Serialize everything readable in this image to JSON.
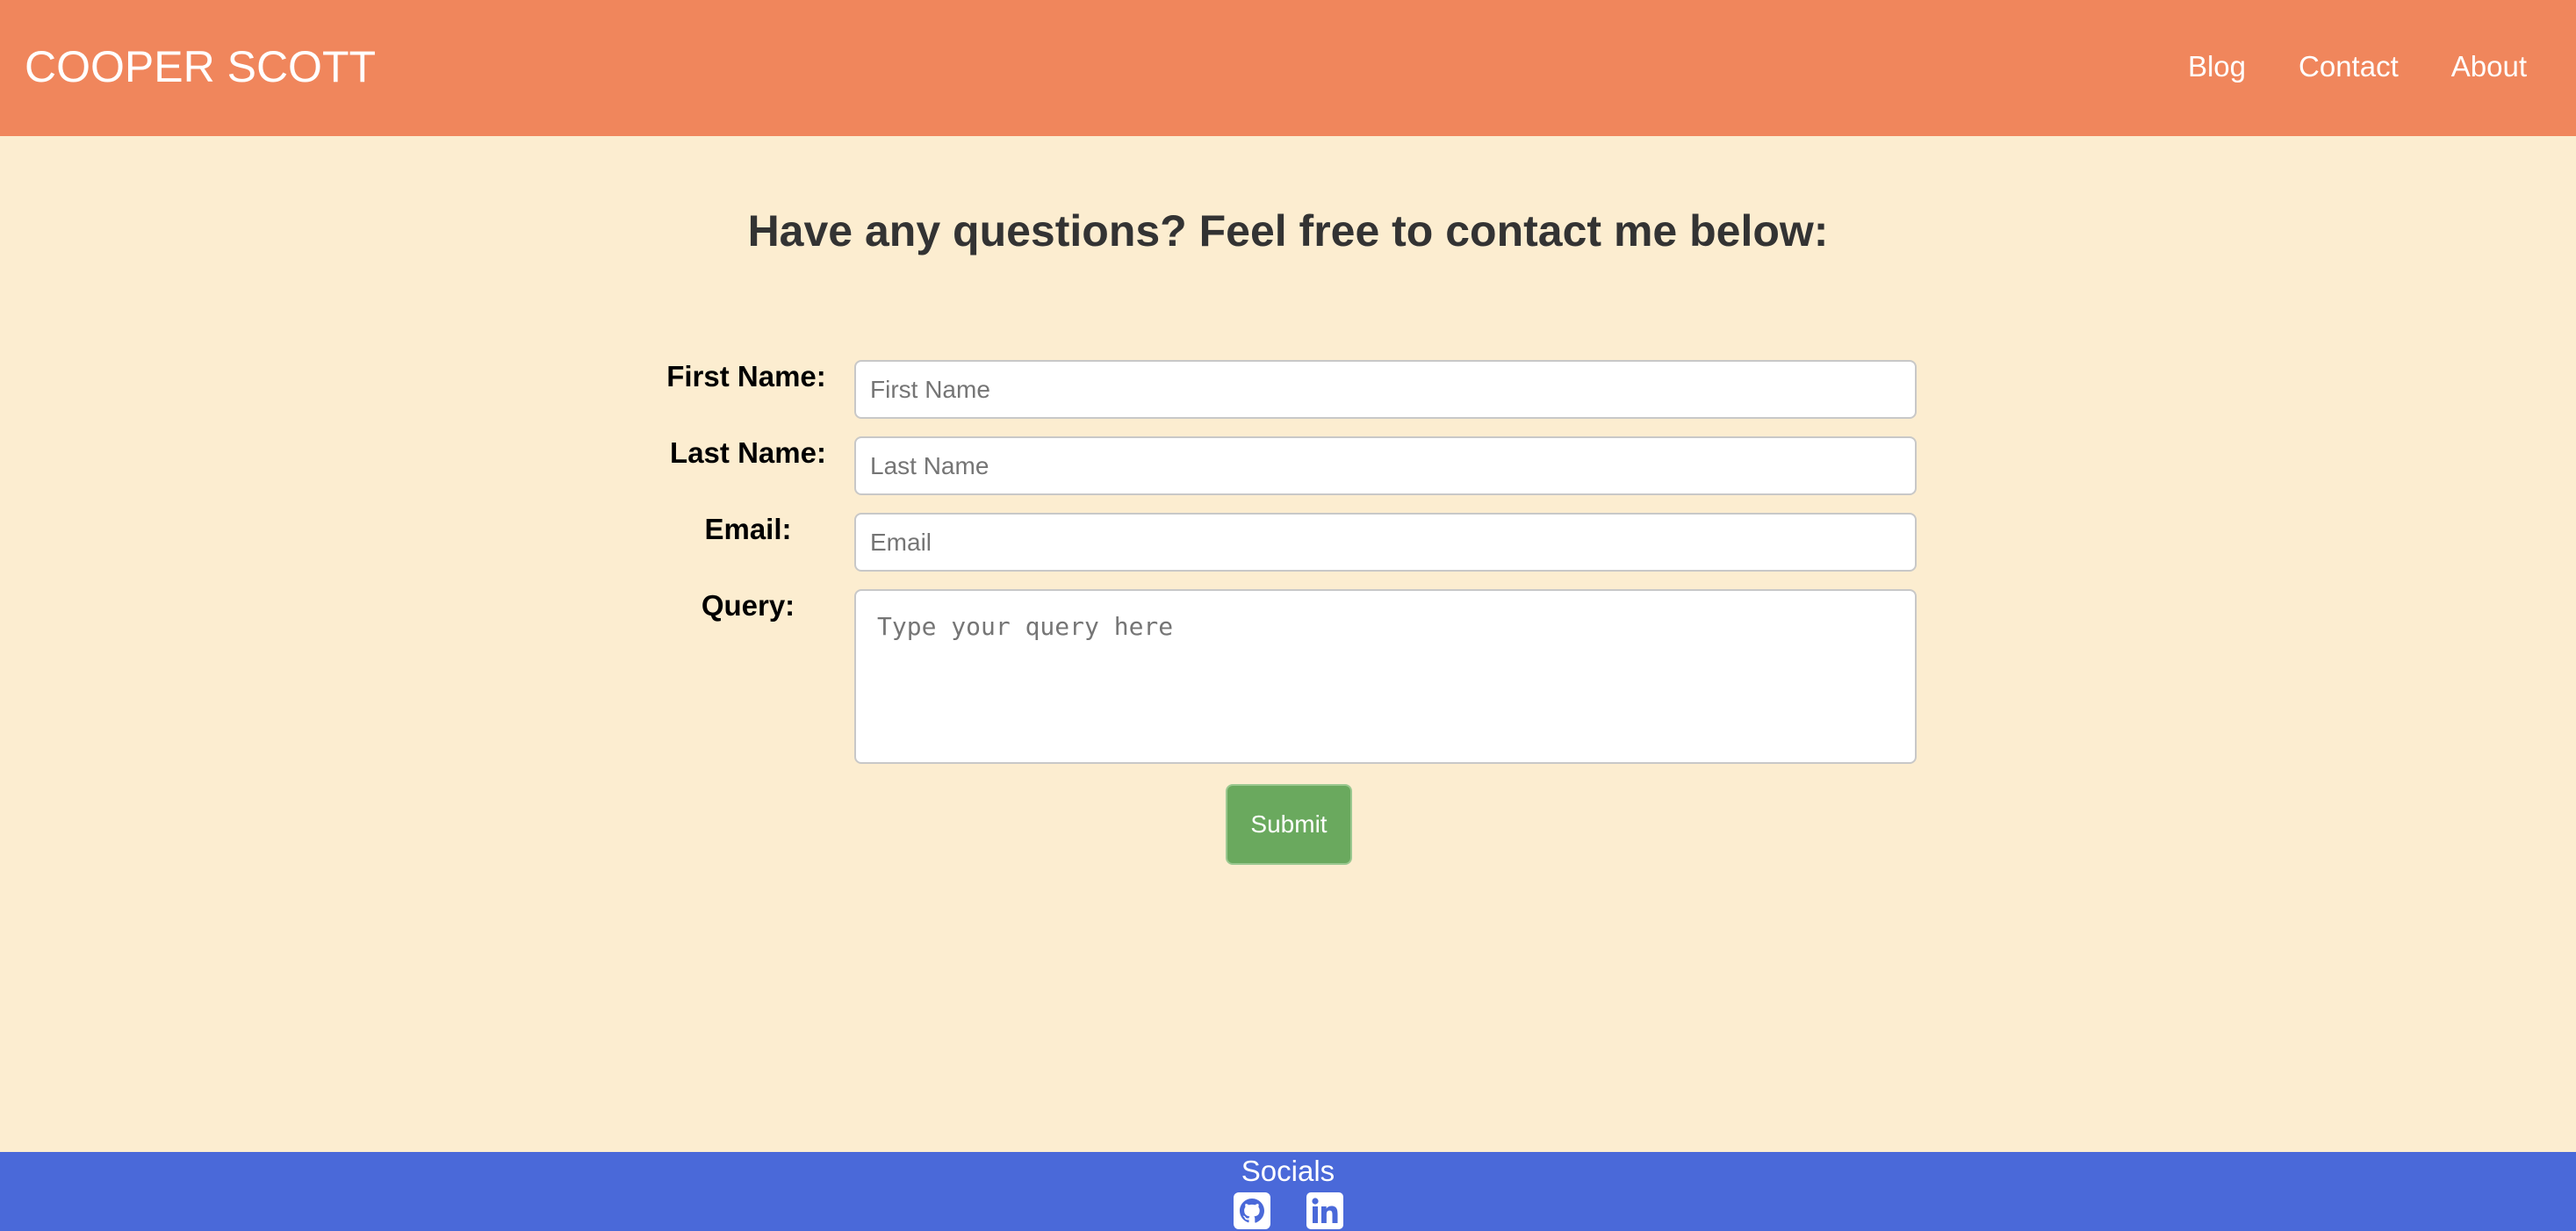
{
  "header": {
    "brand": "COOPER SCOTT",
    "nav": [
      {
        "label": "Blog"
      },
      {
        "label": "Contact"
      },
      {
        "label": "About"
      }
    ]
  },
  "main": {
    "heading": "Have any questions? Feel free to contact me below:",
    "form": {
      "first_name": {
        "label": "First Name:",
        "placeholder": "First Name",
        "value": ""
      },
      "last_name": {
        "label": "Last Name:",
        "placeholder": "Last Name",
        "value": ""
      },
      "email": {
        "label": "Email:",
        "placeholder": "Email",
        "value": ""
      },
      "query": {
        "label": "Query:",
        "placeholder": "Type your query here",
        "value": ""
      },
      "submit_label": "Submit"
    }
  },
  "footer": {
    "title": "Socials",
    "icons": [
      "github-icon",
      "linkedin-icon"
    ]
  },
  "colors": {
    "header_bg": "#f0865c",
    "page_bg": "#fcedd0",
    "footer_bg": "#4a69d9",
    "submit_bg": "#6aa95e"
  }
}
